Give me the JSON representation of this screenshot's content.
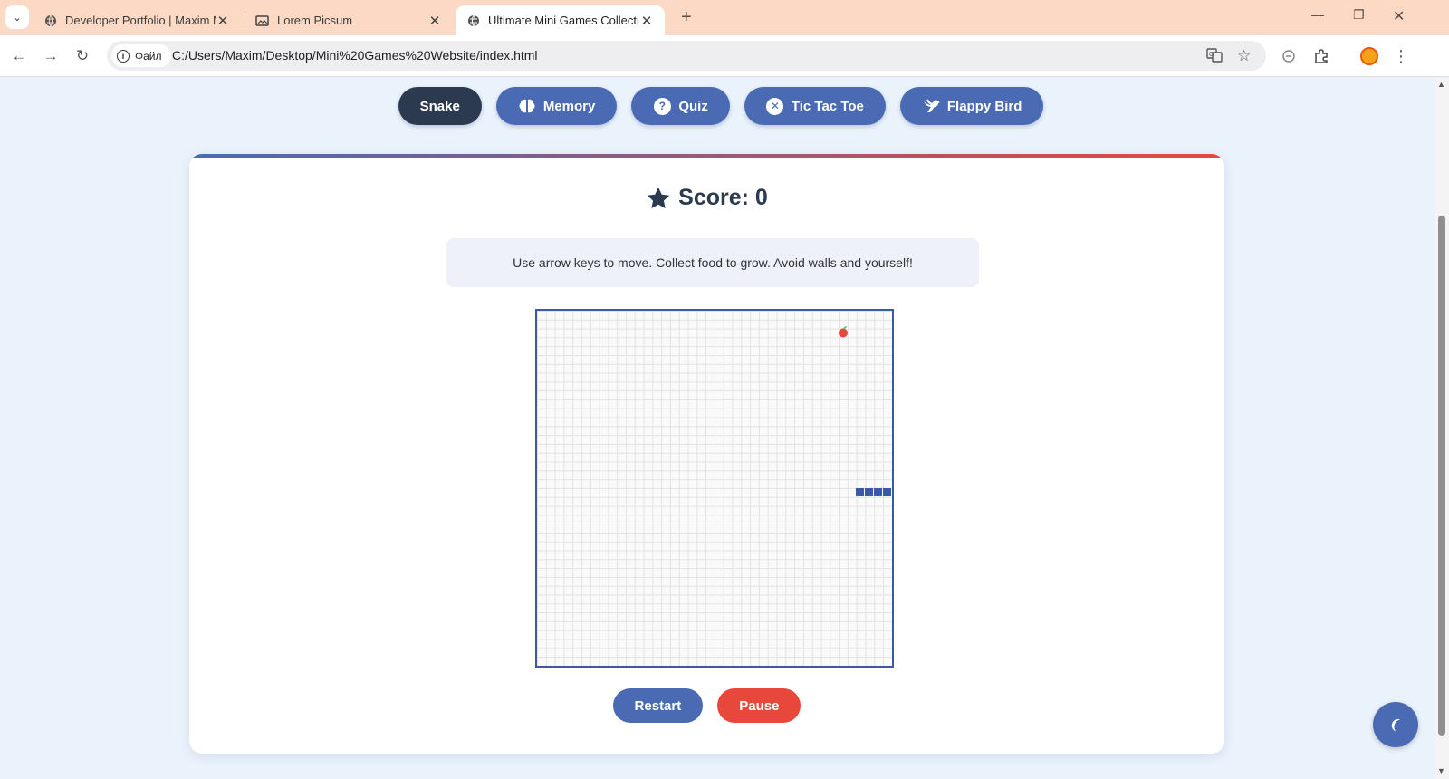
{
  "browser": {
    "tabs": [
      {
        "title": "Developer Portfolio | Maxim Mi",
        "icon": "globe-icon",
        "active": false
      },
      {
        "title": "Lorem Picsum",
        "icon": "image-icon",
        "active": false
      },
      {
        "title": "Ultimate Mini Games Collection",
        "icon": "globe-icon",
        "active": true
      }
    ],
    "site_chip": "Файл",
    "url": "C:/Users/Maxim/Desktop/Mini%20Games%20Website/index.html"
  },
  "page": {
    "nav": [
      {
        "label": "Snake",
        "icon": "",
        "active": true
      },
      {
        "label": "Memory",
        "icon": "brain-icon",
        "active": false
      },
      {
        "label": "Quiz",
        "icon": "question-icon",
        "active": false
      },
      {
        "label": "Tic Tac Toe",
        "icon": "x-circle-icon",
        "active": false
      },
      {
        "label": "Flappy Bird",
        "icon": "dove-icon",
        "active": false
      }
    ],
    "score_label": "Score: 0",
    "instructions": "Use arrow keys to move. Collect food to grow. Avoid walls and yourself!",
    "buttons": {
      "restart": "Restart",
      "pause": "Pause"
    },
    "theme_toggle_icon": "moon-icon",
    "colors": {
      "primary": "#4a6bb4",
      "dark": "#2b3a4f",
      "danger": "#e8473c"
    }
  }
}
